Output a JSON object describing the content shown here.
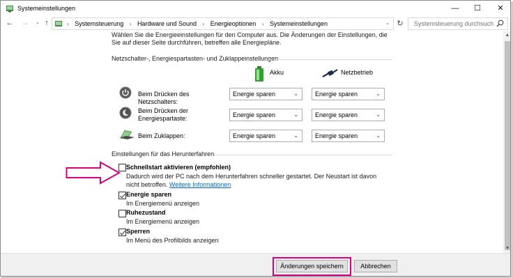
{
  "window": {
    "title": "Systemeinstellungen",
    "controls": {
      "minimize": "—",
      "maximize": "☐",
      "close": "✕"
    }
  },
  "nav": {
    "back": "←",
    "forward": "→",
    "history": "⌄",
    "up": "↑",
    "refresh": "↻",
    "breadcrumbs": [
      "Systemsteuerung",
      "Hardware und Sound",
      "Energieoptionen",
      "Systemeinstellungen"
    ],
    "separator": "›",
    "dropdown": "⌄",
    "search_placeholder": "Systemsteuerung durchsuchen"
  },
  "intro": "Wählen Sie die Energieeinstellungen für den Computer aus. Die Änderungen der Einstellungen, die Sie auf dieser Seite durchführen, betreffen alle Energiepläne.",
  "power_buttons": {
    "group_title": "Netzschalter-, Energiespartasten- und Zuklappeinstellungen",
    "col_battery": "Akku",
    "col_plugged": "Netzbetrieb",
    "rows": [
      {
        "label": "Beim Drücken des Netzschalters:",
        "battery": "Energie sparen",
        "plugged": "Energie sparen",
        "icon": "power-button-icon"
      },
      {
        "label": "Beim Drücken der Energiespartaste:",
        "battery": "Energie sparen",
        "plugged": "Energie sparen",
        "icon": "sleep-button-icon"
      },
      {
        "label": "Beim Zuklappen:",
        "battery": "Energie sparen",
        "plugged": "Energie sparen",
        "icon": "laptop-lid-icon"
      }
    ]
  },
  "shutdown": {
    "group_title": "Einstellungen für das Herunterfahren",
    "options": [
      {
        "title": "Schnellstart aktivieren (empfohlen)",
        "desc": "Dadurch wird der PC nach dem Herunterfahren schneller gestartet. Der Neustart ist davon nicht betroffen.",
        "link": "Weitere Informationen",
        "checked": false
      },
      {
        "title": "Energie sparen",
        "desc": "Im Energiemenü anzeigen",
        "checked": true
      },
      {
        "title": "Ruhezustand",
        "desc": "Im Energiemenü anzeigen",
        "checked": false
      },
      {
        "title": "Sperren",
        "desc": "Im Menü des Profilbilds anzeigen",
        "checked": true
      }
    ]
  },
  "buttons": {
    "save": "Änderungen speichern",
    "cancel": "Abbrechen"
  },
  "colors": {
    "highlight": "#d8007f",
    "link": "#0066cc",
    "footer_bg": "#f0f0f0"
  }
}
